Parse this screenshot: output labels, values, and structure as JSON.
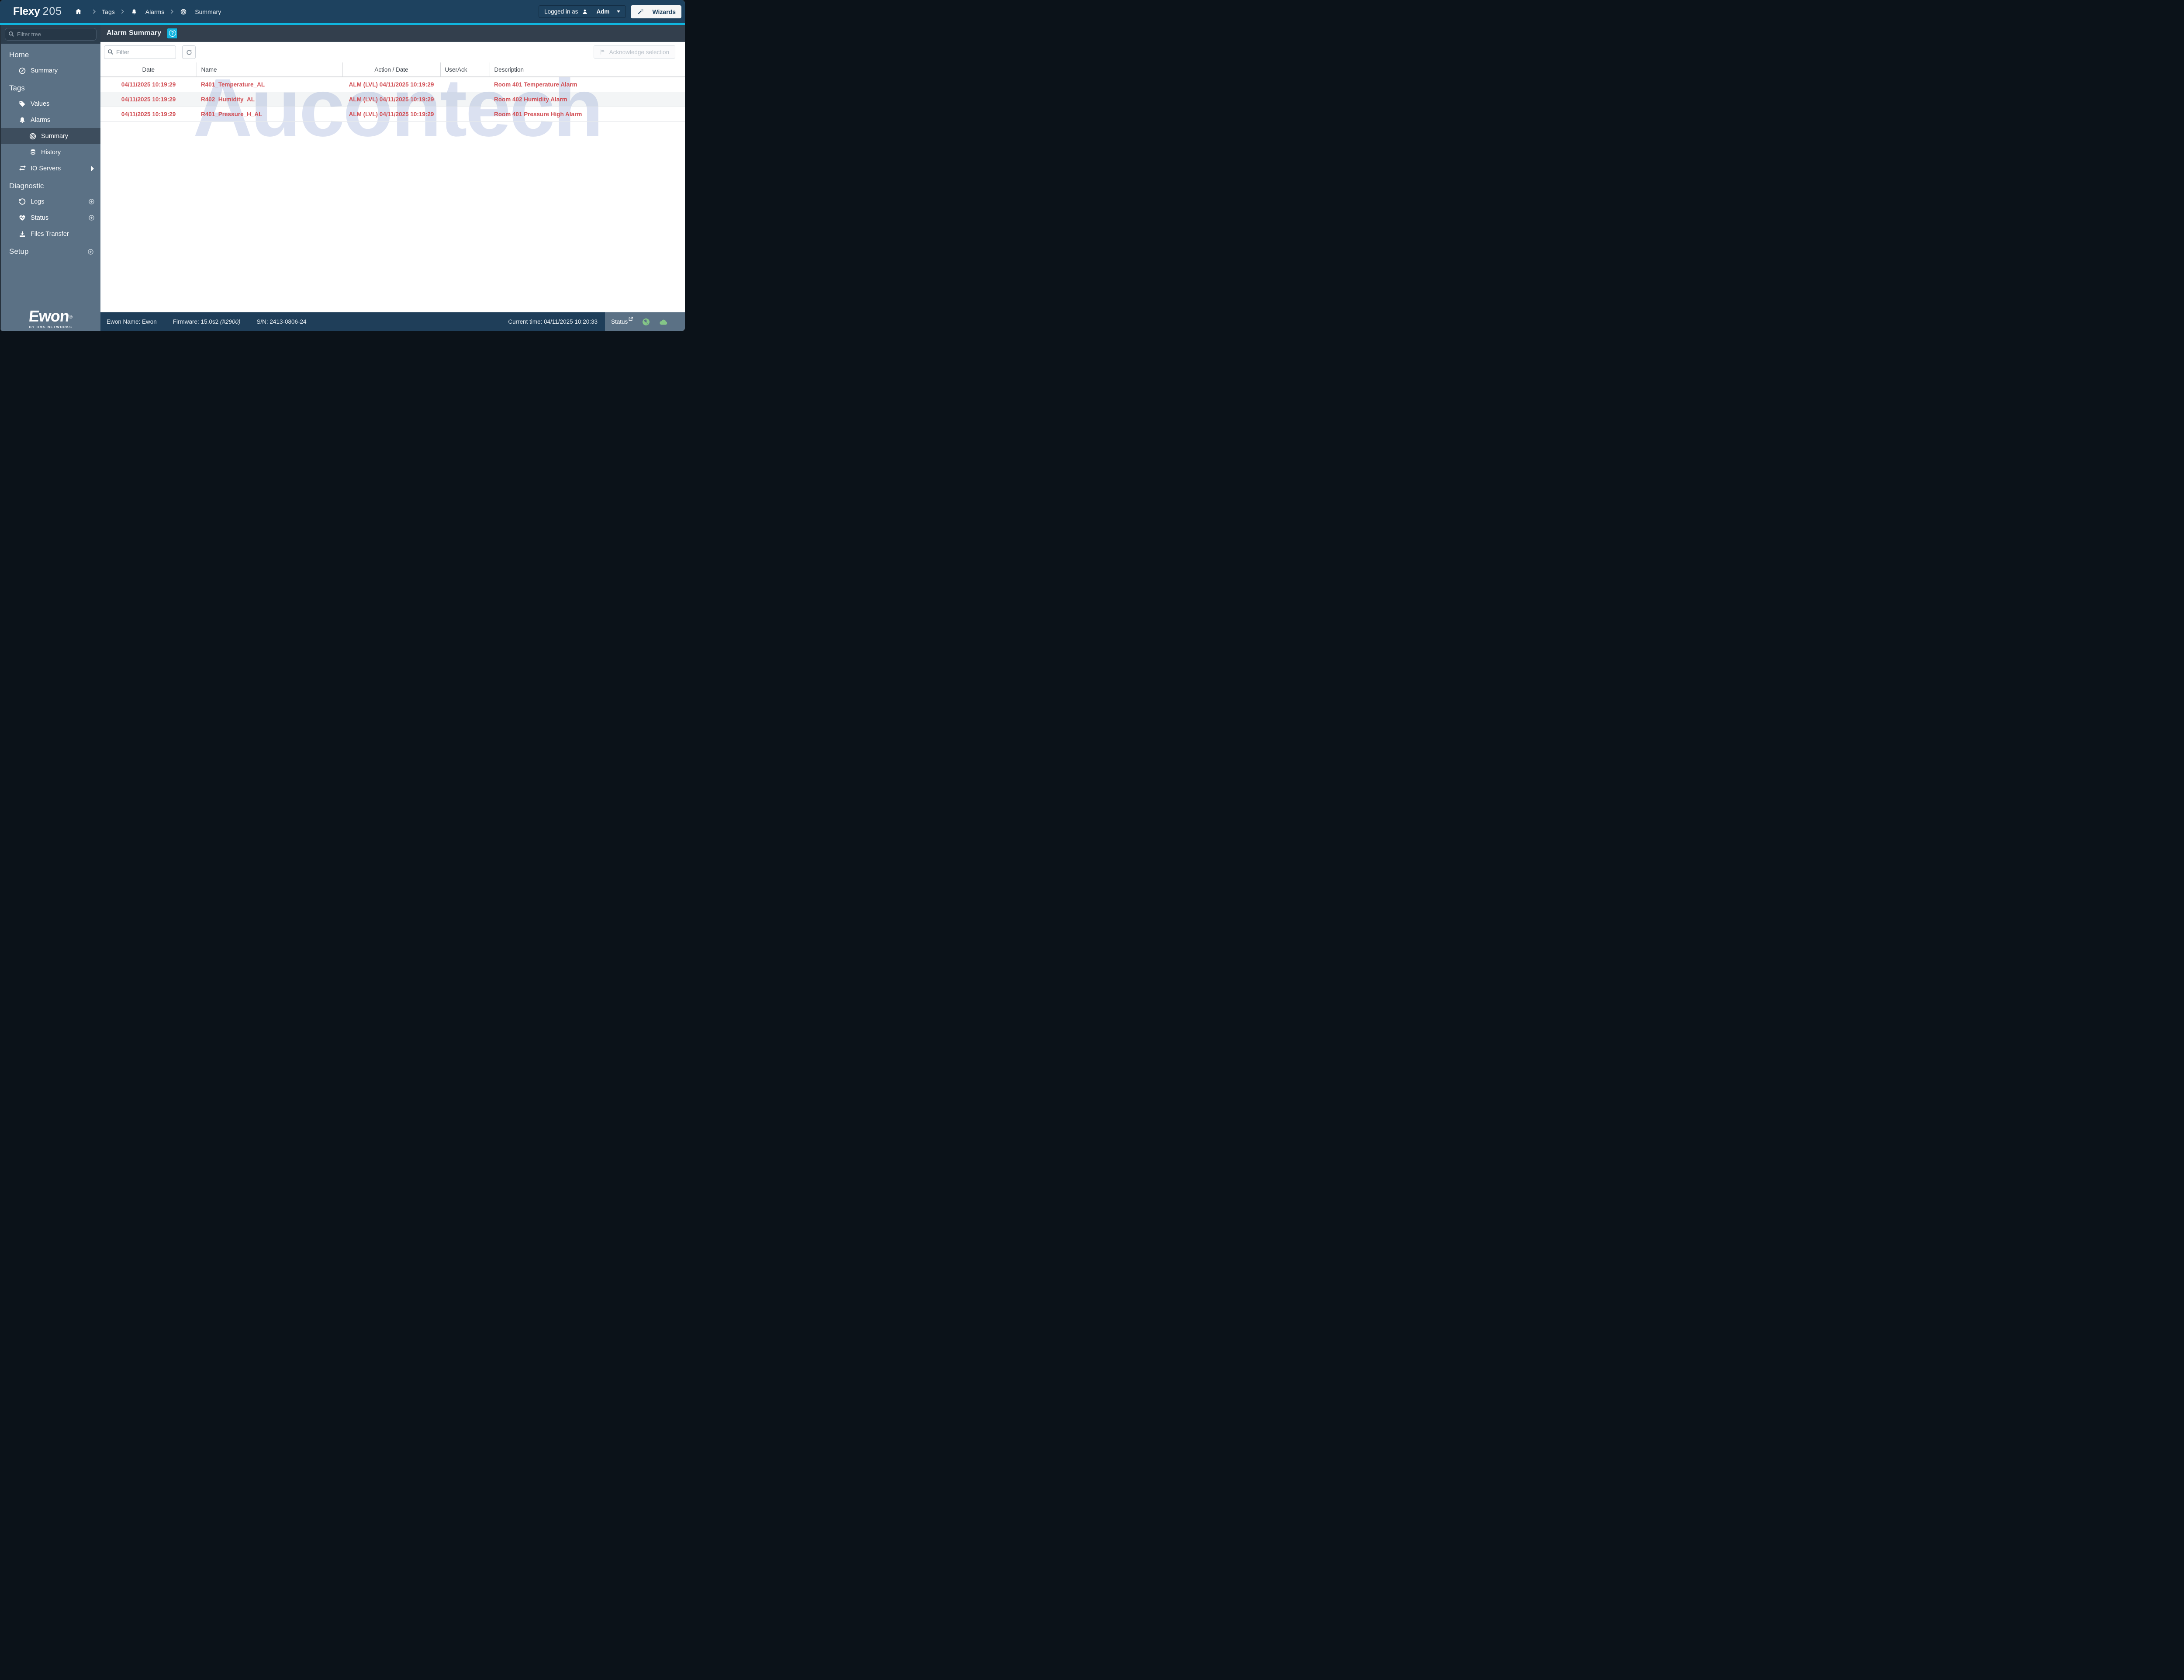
{
  "colors": {
    "accent_cyan": "#10b6e0",
    "alarm_red": "#d25056",
    "ok_green": "#84c587",
    "topbar_navy": "#1e425f",
    "sidebar_slate": "#5b7185"
  },
  "topbar": {
    "brand_bold": "Flexy",
    "brand_light": "205",
    "breadcrumb": [
      {
        "label": "Tags"
      },
      {
        "label": "Alarms"
      },
      {
        "label": "Summary"
      }
    ],
    "login_prefix": "Logged in as",
    "login_user": "Adm",
    "wizards_label": "Wizards"
  },
  "sidebar": {
    "filter_placeholder": "Filter tree",
    "sections": [
      {
        "label": "Home"
      },
      {
        "label": "Tags"
      },
      {
        "label": "Diagnostic"
      },
      {
        "label": "Setup"
      }
    ],
    "items": {
      "home_summary": "Summary",
      "values": "Values",
      "alarms": "Alarms",
      "alarm_summary": "Summary",
      "history": "History",
      "io_servers": "IO Servers",
      "logs": "Logs",
      "status": "Status",
      "files_transfer": "Files Transfer"
    },
    "logo_text": "Ewon",
    "logo_reg": "®",
    "logo_sub": "BY HMS NETWORKS"
  },
  "page": {
    "title": "Alarm Summary",
    "help": "?"
  },
  "toolbar": {
    "filter_placeholder": "Filter",
    "acknowledge_label": "Acknowledge selection"
  },
  "table": {
    "columns": [
      "Date",
      "Name",
      "Action / Date",
      "UserAck",
      "Description"
    ],
    "rows": [
      {
        "date": "04/11/2025 10:19:29",
        "name": "R401_Temperature_AL",
        "action": "ALM (LVL) 04/11/2025 10:19:29",
        "userack": "",
        "description": "Room 401 Temperature Alarm"
      },
      {
        "date": "04/11/2025 10:19:29",
        "name": "R402_Humidity_AL",
        "action": "ALM (LVL) 04/11/2025 10:19:29",
        "userack": "",
        "description": "Room 402 Humidity Alarm"
      },
      {
        "date": "04/11/2025 10:19:29",
        "name": "R401_Pressure_H_AL",
        "action": "ALM (LVL) 04/11/2025 10:19:29",
        "userack": "",
        "description": "Room 401 Pressure High Alarm"
      }
    ]
  },
  "watermark": "Aucontech",
  "footer": {
    "ewon_name": "Ewon Name: Ewon",
    "firmware": "Firmware: 15.0s2",
    "firmware_build": "(#2900)",
    "serial": "S/N: 2413-0806-24",
    "current_time": "Current time: 04/11/2025 10:20:33",
    "status_label": "Status"
  }
}
